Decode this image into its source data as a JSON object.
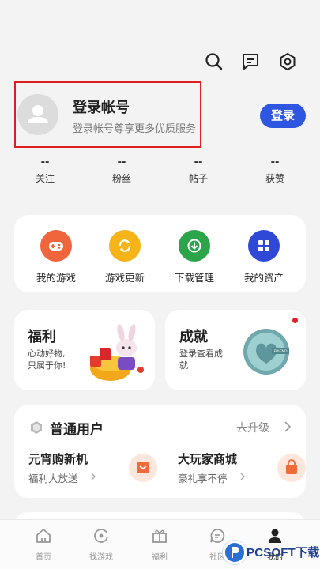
{
  "header": {
    "icons": [
      "search-icon",
      "message-icon",
      "settings-icon"
    ]
  },
  "profile": {
    "title": "登录帐号",
    "subtitle": "登录帐号尊享更多优质服务",
    "login_button": "登录"
  },
  "stats": [
    {
      "value": "--",
      "label": "关注"
    },
    {
      "value": "--",
      "label": "粉丝"
    },
    {
      "value": "--",
      "label": "帖子"
    },
    {
      "value": "--",
      "label": "获赞"
    }
  ],
  "tools": [
    {
      "label": "我的游戏",
      "icon": "gamepad-icon",
      "color": "#f0653b"
    },
    {
      "label": "游戏更新",
      "icon": "refresh-icon",
      "color": "#f5b417"
    },
    {
      "label": "下载管理",
      "icon": "download-icon",
      "color": "#2ca54a"
    },
    {
      "label": "我的资产",
      "icon": "grid-icon",
      "color": "#2f48d6"
    }
  ],
  "welfare": {
    "title": "福利",
    "desc": "心动好物,只属于你!"
  },
  "achievement": {
    "title": "成就",
    "desc": "登录查看成就",
    "badge_text": "FRIEND"
  },
  "membership": {
    "level": "普通用户",
    "upgrade": "去升级",
    "items": [
      {
        "title": "元宵购新机",
        "sub": "福利大放送"
      },
      {
        "title": "大玩家商城",
        "sub": "豪礼享不停"
      }
    ]
  },
  "tabs": [
    {
      "label": "首页"
    },
    {
      "label": "找游戏"
    },
    {
      "label": "福利"
    },
    {
      "label": "社区"
    },
    {
      "label": "我的"
    }
  ],
  "watermark": "PCSOFT下载"
}
